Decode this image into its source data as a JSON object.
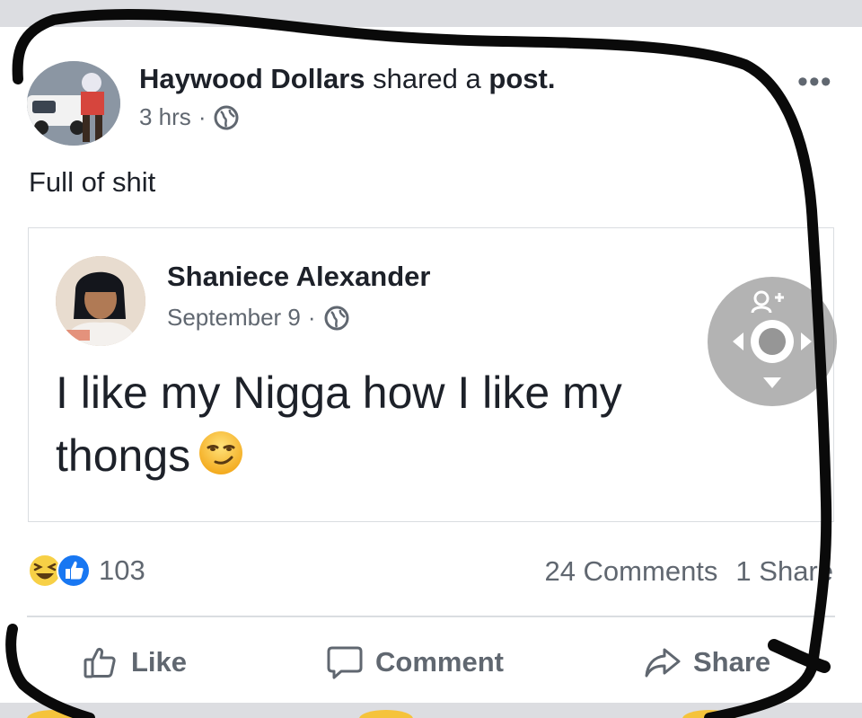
{
  "post": {
    "sharer_name": "Haywood Dollars",
    "shared_text": "shared a",
    "post_word": "post.",
    "time": "3 hrs",
    "separator": "·",
    "privacy_icon": "globe-icon",
    "more_label": "•••",
    "text": "Full of shit"
  },
  "shared_post": {
    "author": "Shaniece Alexander",
    "date": "September 9",
    "separator": "·",
    "privacy_icon": "globe-icon",
    "text": "I like my Nigga how I like my thongs",
    "emoji": "smirking-face-emoji"
  },
  "stats": {
    "reaction_icons": [
      "laughing-reaction-icon",
      "like-reaction-icon"
    ],
    "reaction_count": "103",
    "comments": "24 Comments",
    "shares": "1 Share"
  },
  "actions": {
    "like_label": "Like",
    "comment_label": "Comment",
    "share_label": "Share"
  },
  "colors": {
    "like_blue": "#1877f2",
    "text_primary": "#1d2129",
    "text_secondary": "#606770",
    "emoji_yellow": "#f5c33b"
  }
}
